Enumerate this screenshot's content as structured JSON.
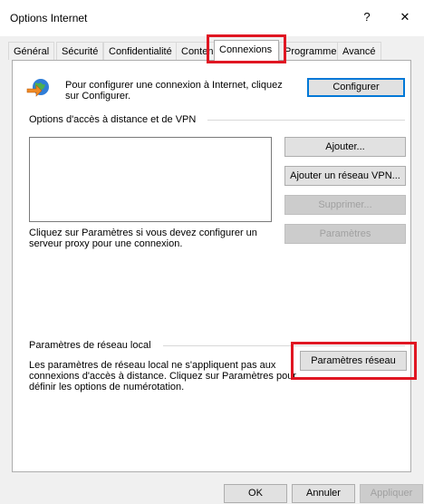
{
  "window": {
    "title": "Options Internet",
    "help_glyph": "?",
    "close_glyph": "✕"
  },
  "tabs": [
    {
      "label": "Général"
    },
    {
      "label": "Sécurité"
    },
    {
      "label": "Confidentialité"
    },
    {
      "label": "Contenu"
    },
    {
      "label": "Connexions",
      "selected": true
    },
    {
      "label": "Programmes"
    },
    {
      "label": "Avancé"
    }
  ],
  "setup": {
    "text_line1": "Pour configurer une connexion à Internet, cliquez",
    "text_line2": "sur Configurer.",
    "button": "Configurer"
  },
  "dialup": {
    "group_label": "Options d'accès à distance et de VPN",
    "add_button": "Ajouter...",
    "add_vpn_button": "Ajouter un réseau VPN...",
    "remove_button": "Supprimer...",
    "settings_button": "Paramètres",
    "proxy_text_line1": "Cliquez sur Paramètres si vous devez configurer un",
    "proxy_text_line2": "serveur proxy pour une connexion."
  },
  "lan": {
    "group_label": "Paramètres de réseau local",
    "text_line1": "Les paramètres de réseau local ne s'appliquent pas aux",
    "text_line2": "connexions d'accès à distance. Cliquez sur Paramètres pour",
    "text_line3": "définir les options de numérotation.",
    "button": "Paramètres réseau"
  },
  "footer": {
    "ok": "OK",
    "cancel": "Annuler",
    "apply": "Appliquer"
  },
  "colors": {
    "highlight_box": "#e01622",
    "default_button_border": "#0078d7"
  }
}
